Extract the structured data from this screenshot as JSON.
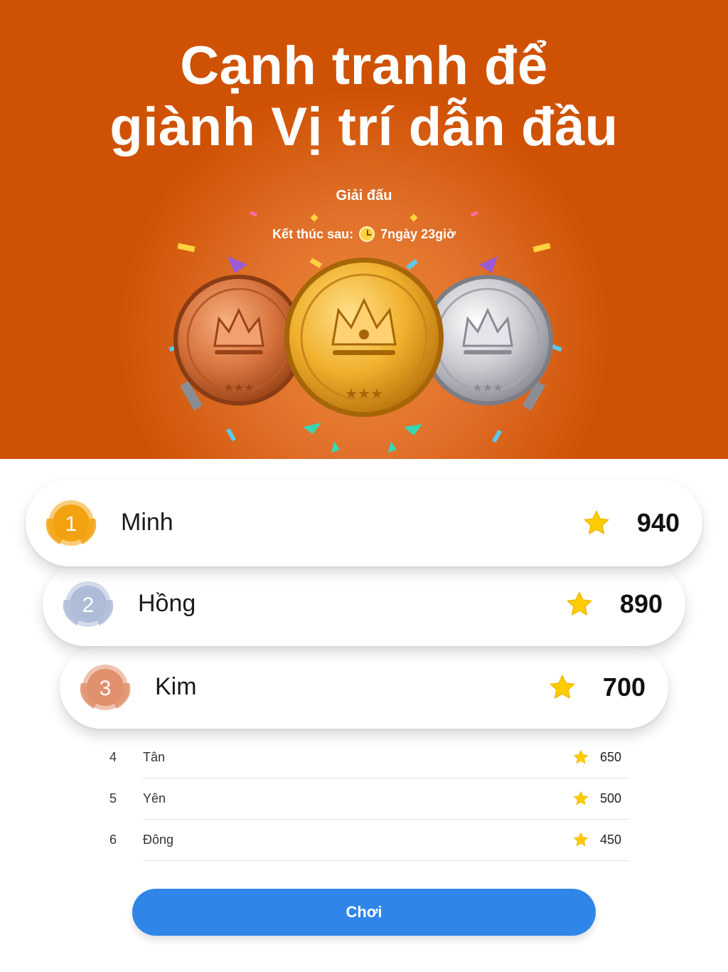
{
  "hero": {
    "headline_line1": "Cạnh tranh để",
    "headline_line2": "giành Vị trí dẫn đầu",
    "tournament_title": "Giải đấu",
    "countdown_label": "Kết thúc sau:",
    "countdown_value": "7ngày 23giờ",
    "background_color": "#cf5204"
  },
  "podium": [
    {
      "rank": "1",
      "name": "Minh",
      "score": "940",
      "badge_color": "#f2a20f"
    },
    {
      "rank": "2",
      "name": "Hồng",
      "score": "890",
      "badge_color": "#aebcd8"
    },
    {
      "rank": "3",
      "name": "Kim",
      "score": "700",
      "badge_color": "#e0906c"
    }
  ],
  "list": [
    {
      "rank": "4",
      "name": "Tân",
      "score": "650"
    },
    {
      "rank": "5",
      "name": "Yên",
      "score": "500"
    },
    {
      "rank": "6",
      "name": "Đông",
      "score": "450"
    }
  ],
  "play_button": {
    "label": "Chơi",
    "color": "#2f86e8"
  },
  "icons": {
    "score": "star-icon",
    "countdown": "clock-icon"
  },
  "star_color": "#ffcc00"
}
